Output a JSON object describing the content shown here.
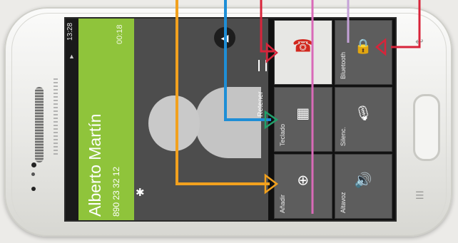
{
  "status_bar": {
    "time": "13:28",
    "signal_icon": "signal-icon"
  },
  "call": {
    "caller_name": "Alberto Martín",
    "caller_number": "890 23 32 12",
    "timer": "00:18"
  },
  "actions": [
    {
      "id": "keypad",
      "label": "Teclado",
      "icon": "keypad-icon"
    },
    {
      "id": "end",
      "label": "",
      "icon": "end-call-icon"
    },
    {
      "id": "bluetooth",
      "label": "Bluetooth",
      "icon": "bluetooth-icon"
    },
    {
      "id": "mute",
      "label": "Silenc.",
      "icon": "mute-icon"
    },
    {
      "id": "add",
      "label": "Añadir",
      "icon": "add-call-icon"
    },
    {
      "id": "speaker",
      "label": "Altavoz",
      "icon": "speaker-icon"
    }
  ],
  "pause": {
    "label": "Retener"
  },
  "callout_colors": {
    "orange": "#f2a11e",
    "blue": "#1e8ed6",
    "red": "#d8243a",
    "pink": "#d96ab8",
    "lilac": "#c5a2d8"
  }
}
